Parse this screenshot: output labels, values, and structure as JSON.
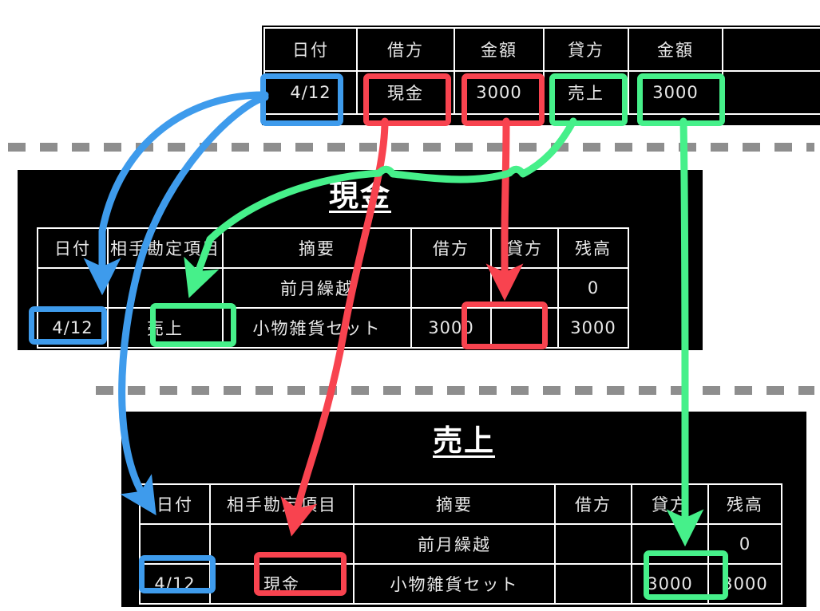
{
  "colors": {
    "blue": "#3e9bec",
    "red": "#f8434f",
    "green": "#46f08a",
    "dash_gray": "#8e8e8e",
    "table_bg": "#000000",
    "table_text": "#e8e8e8",
    "page_bg": "#ffffff"
  },
  "journal": {
    "name": "journal-entry-table",
    "headers": [
      "日付",
      "借方",
      "金額",
      "貸方",
      "金額",
      ""
    ],
    "rows": [
      [
        "4/12",
        "現金",
        "3000",
        "売上",
        "3000",
        ""
      ]
    ]
  },
  "cash_ledger": {
    "title": "現金",
    "headers": [
      "日付",
      "相手勘定項目",
      "摘要",
      "借方",
      "貸方",
      "残高"
    ],
    "rows": [
      [
        "",
        "",
        "前月繰越",
        "",
        "",
        "0"
      ],
      [
        "4/12",
        "売上",
        "小物雑貨セット",
        "3000",
        "",
        "3000"
      ]
    ]
  },
  "sales_ledger": {
    "title": "売上",
    "headers": [
      "日付",
      "相手勘定項目",
      "摘要",
      "借方",
      "貸方",
      "残高"
    ],
    "rows": [
      [
        "",
        "",
        "前月繰越",
        "",
        "",
        "0"
      ],
      [
        "4/12",
        "現金",
        "小物雑貨セット",
        "",
        "3000",
        "3000"
      ]
    ]
  },
  "highlights": [
    {
      "id": "journal-date",
      "color": "blue",
      "value": "4/12"
    },
    {
      "id": "journal-debit",
      "color": "red",
      "value": "現金"
    },
    {
      "id": "journal-debit-amt",
      "color": "red",
      "value": "3000"
    },
    {
      "id": "journal-credit",
      "color": "green",
      "value": "売上"
    },
    {
      "id": "journal-credit-amt",
      "color": "green",
      "value": "3000"
    },
    {
      "id": "cash-date",
      "color": "blue",
      "value": "4/12"
    },
    {
      "id": "cash-contra",
      "color": "green",
      "value": "売上"
    },
    {
      "id": "cash-debit",
      "color": "red",
      "value": "3000"
    },
    {
      "id": "sales-date",
      "color": "blue",
      "value": "4/12"
    },
    {
      "id": "sales-contra",
      "color": "red",
      "value": "現金"
    },
    {
      "id": "sales-credit",
      "color": "green",
      "value": "3000"
    }
  ],
  "arrows": [
    {
      "id": "date-to-cash-date",
      "color": "blue",
      "from": "journal-date",
      "to": "cash-date"
    },
    {
      "id": "date-to-sales-date",
      "color": "blue",
      "from": "journal-date",
      "to": "sales-date"
    },
    {
      "id": "debit-to-sales-contra",
      "color": "red",
      "from": "journal-debit",
      "to": "sales-contra"
    },
    {
      "id": "debit-amt-to-cash-debit",
      "color": "red",
      "from": "journal-debit-amt",
      "to": "cash-debit"
    },
    {
      "id": "credit-to-cash-contra",
      "color": "green",
      "from": "journal-credit",
      "to": "cash-contra"
    },
    {
      "id": "credit-amt-to-sales-credit",
      "color": "green",
      "from": "journal-credit-amt",
      "to": "sales-credit"
    }
  ]
}
